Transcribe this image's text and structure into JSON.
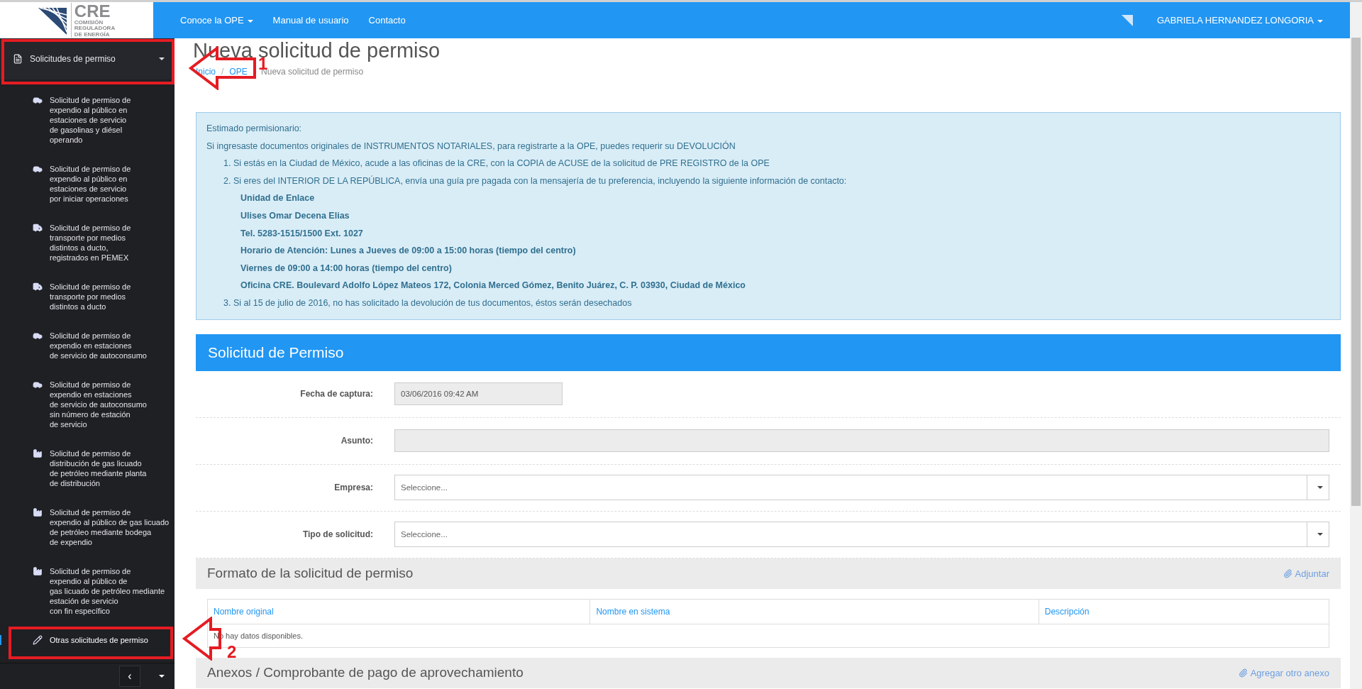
{
  "header": {
    "logo": {
      "text": "CRE",
      "lines": [
        "COMISIÓN",
        "REGULADORA",
        "DE ENERGÍA"
      ]
    },
    "nav": [
      {
        "label": "Conoce la OPE",
        "has_caret": true
      },
      {
        "label": "Manual de usuario",
        "has_caret": false
      },
      {
        "label": "Contacto",
        "has_caret": false
      }
    ],
    "user": {
      "name": "GABRIELA HERNANDEZ LONGORIA",
      "has_caret": true
    }
  },
  "sidebar": {
    "section": {
      "label": "Solicitudes de permiso",
      "expanded": true
    },
    "items": [
      {
        "kind": "car",
        "label": "Solicitud de permiso de\nexpendio al público en\nestaciones de servicio\nde gasolinas y diésel\noperando",
        "selected": false
      },
      {
        "kind": "car",
        "label": "Solicitud de permiso de\nexpendio al público en\nestaciones de servicio\npor iniciar operaciones",
        "selected": false
      },
      {
        "kind": "truck",
        "label": "Solicitud de permiso de\ntransporte por medios\ndistintos a ducto,\nregistrados en PEMEX",
        "selected": false
      },
      {
        "kind": "truck",
        "label": "Solicitud de permiso de\ntransporte por medios\ndistintos a ducto",
        "selected": false
      },
      {
        "kind": "car",
        "label": "Solicitud de permiso de\nexpendio en estaciones\nde servicio de autoconsumo",
        "selected": false
      },
      {
        "kind": "car",
        "label": "Solicitud de permiso de\nexpendio en estaciones\nde servicio de autoconsumo\nsin número de estación\nde servicio",
        "selected": false
      },
      {
        "kind": "factory",
        "label": "Solicitud de permiso de\ndistribución de gas licuado\nde petróleo mediante planta\nde distribución",
        "selected": false
      },
      {
        "kind": "factory",
        "label": "Solicitud de permiso de\nexpendio al público de gas licuado\nde petróleo mediante bodega\nde expendio",
        "selected": false
      },
      {
        "kind": "factory",
        "label": "Solicitud de permiso de\nexpendio al público de\ngas licuado de petróleo mediante\nestación de servicio\ncon fin específico",
        "selected": false
      },
      {
        "kind": "pencil",
        "label": "Otras solicitudes de permiso",
        "selected": true
      }
    ],
    "footer": {
      "collapse_label": "‹"
    }
  },
  "page": {
    "title": "Nueva solicitud de permiso",
    "separator": "/",
    "breadcrumb": [
      {
        "label": "Inicio",
        "link": true
      },
      {
        "label": "OPE",
        "link": true
      },
      {
        "label": "Nueva solicitud de permiso",
        "link": false
      }
    ]
  },
  "alert": {
    "greeting": "Estimado permisionario:",
    "intro": "Si ingresaste documentos originales de INSTRUMENTOS NOTARIALES, para registrarte a la OPE, puedes requerir su DEVOLUCIÓN",
    "items": [
      {
        "number": "1.",
        "text": "Si estás en la Ciudad de México, acude a las oficinas de la CRE, con la COPIA de ACUSE de la solicitud de PRE REGISTRO de la OPE"
      },
      {
        "number": "2.",
        "text": "Si eres del INTERIOR DE LA REPÚBLICA, envía una guía pre pagada con la mensajería de tu preferencia, incluyendo la siguiente información de contacto:",
        "contact": [
          "Unidad de Enlace",
          "Ulises Omar Decena Elias",
          "Tel. 5283-1515/1500 Ext. 1027",
          "Horario de Atención: Lunes a Jueves de 09:00 a 15:00 horas (tiempo del centro)",
          "Viernes de 09:00 a 14:00 horas (tiempo del centro)",
          "Oficina CRE. Boulevard Adolfo López Mateos 172, Colonia Merced Gómez, Benito Juárez, C. P. 03930, Ciudad de México"
        ]
      },
      {
        "number": "3.",
        "text": "Si al 15 de julio de 2016, no has solicitado la devolución de tus documentos, éstos serán desechados"
      }
    ]
  },
  "form": {
    "title": "Solicitud de Permiso",
    "fields": [
      {
        "kind": "input",
        "label": "Fecha de captura:",
        "value": "03/06/2016 09:42 AM",
        "disabled": true,
        "short": true
      },
      {
        "kind": "input",
        "label": "Asunto:",
        "disabled": true,
        "short": false
      },
      {
        "kind": "select",
        "label": "Empresa:",
        "placeholder": "Seleccione..."
      },
      {
        "kind": "select",
        "label": "Tipo de solicitud:",
        "placeholder": "Seleccione..."
      }
    ],
    "sections": [
      {
        "title": "Formato de la solicitud de permiso",
        "action": "Adjuntar",
        "table": {
          "columns": [
            "Nombre original",
            "Nombre en sistema",
            "Descripción"
          ],
          "empty": "No hay datos disponibles."
        }
      },
      {
        "title": "Anexos / Comprobante de pago de aprovechamiento",
        "action": "Agregar otro anexo"
      }
    ]
  },
  "annotations": [
    {
      "number": "1"
    },
    {
      "number": "2"
    }
  ]
}
